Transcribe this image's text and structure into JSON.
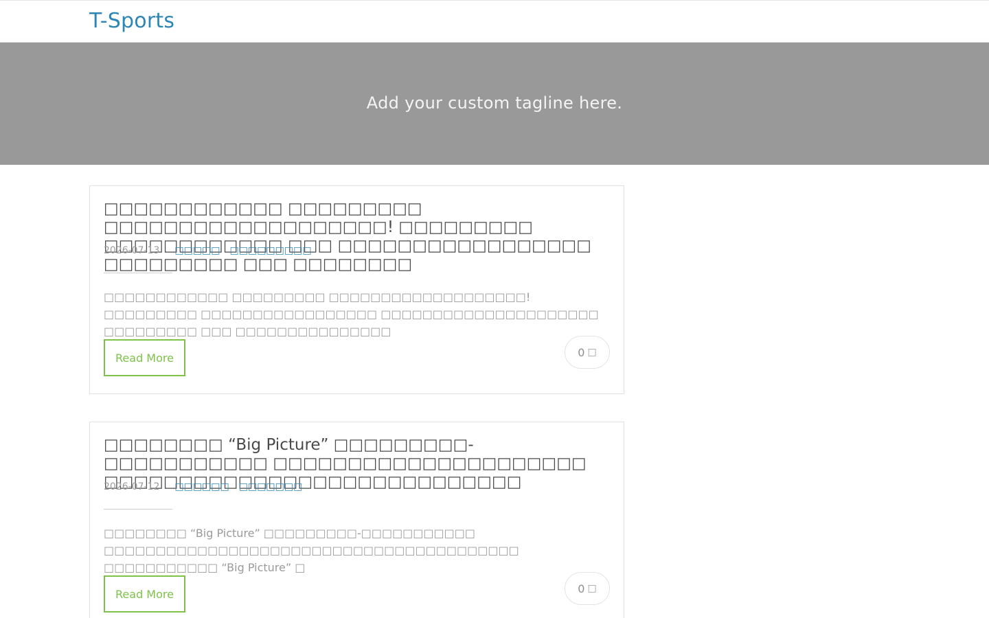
{
  "site": {
    "title": "T-Sports",
    "tagline": "Add your custom tagline here."
  },
  "posts": [
    {
      "title": "□□□□□□□□□□□□ □□□□□□□□□ □□□□□□□□□□□□□□□□□□□! □□□□□□□□□ □□□□□□□□□□□□ □□□ □□□□□□□□□□□□□□□□□ □□□□□□□□□ □□□ □□□□□□□□",
      "date": "2026-07-13",
      "categories": [
        "□□□□□",
        "□□□□□□□□□"
      ],
      "excerpt": "□□□□□□□□□□□□ □□□□□□□□□ □□□□□□□□□□□□□□□□□□□! □□□□□□□□□ □□□□□□□□□□□□□□□□□ □□□□□□□□□□□□□□□□□□□□□ □□□□□□□□□ □□□ □□□□□□□□□□□□□□□",
      "read_more": "Read More",
      "comment_count": "0",
      "comment_icon": "□"
    },
    {
      "title": "□□□□□□□□ “Big Picture” □□□□□□□□□-□□□□□□□□□□□ □□□□□□□□□□□□□□□□□□□□□ □□□□□□□□□□□□□□□□□□□□□□□□□□□□",
      "date": "2026-07-12",
      "categories": [
        "□□□□□□",
        "□□□□□□□"
      ],
      "excerpt": "□□□□□□□□ “Big Picture” □□□□□□□□□-□□□□□□□□□□□ □□□□□□□□□□□□□□□□□□□□□□□□□□□□□□□□□□□□□□□□ □□□□□□□□□□□ “Big Picture” □",
      "read_more": "Read More",
      "comment_count": "0",
      "comment_icon": "□"
    }
  ]
}
